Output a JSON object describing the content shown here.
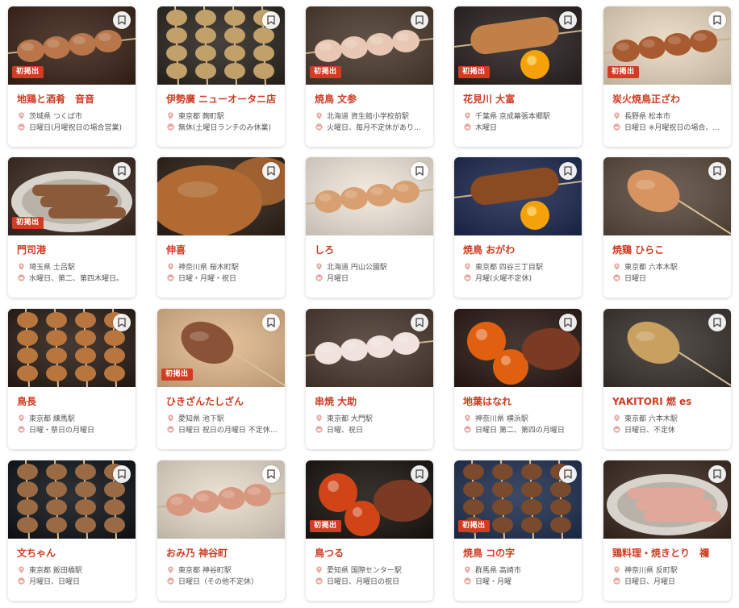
{
  "colors": {
    "accent": "#cf3c22",
    "badge_bg": "#d23c22",
    "meta_text": "#555555",
    "icon_pink": "#e8a9a2"
  },
  "icons": {
    "bookmark": "bookmark-icon",
    "location": "location-pin-icon",
    "holiday": "closed-day-icon"
  },
  "cards": [
    {
      "name": "地鶏と酒肴　音音",
      "location": "茨城県 つくば市",
      "holiday": "日曜日(月曜祝日の場合営業)",
      "badge": "初掲出",
      "photo": {
        "bg": "#3a2418",
        "food": "#b9764a",
        "style": "skewer"
      }
    },
    {
      "name": "伊勢廣 ニューオータニ店",
      "location": "東京都 麹町駅",
      "holiday": "無休(土曜日ランチのみ休業)",
      "badge": "",
      "photo": {
        "bg": "#2b2620",
        "food": "#c2a06a",
        "style": "sticks"
      }
    },
    {
      "name": "焼鳥 文参",
      "location": "北海道 資生館小学校前駅",
      "holiday": "火曜日、毎月不定休があり…",
      "badge": "初掲出",
      "photo": {
        "bg": "#4a3a2c",
        "food": "#e8c8b4",
        "style": "skewer"
      }
    },
    {
      "name": "花見川 大富",
      "location": "千葉県 京成幕張本郷駅",
      "holiday": "木曜日",
      "badge": "初掲出",
      "photo": {
        "bg": "#2a2220",
        "food": "#c08048",
        "style": "tsukune-yolk"
      }
    },
    {
      "name": "炭火焼鳥正ざわ",
      "location": "長野県 松本市",
      "holiday": "日曜日 ※月曜祝日の場合、…",
      "badge": "初掲出",
      "photo": {
        "bg": "#e8d8c0",
        "food": "#a85a30",
        "style": "skewer"
      }
    },
    {
      "name": "門司港",
      "location": "埼玉県 土呂駅",
      "holiday": "水曜日、第二、第四木曜日。",
      "badge": "初掲出",
      "photo": {
        "bg": "#3c2a22",
        "food": "#8a5a3a",
        "style": "plate"
      }
    },
    {
      "name": "伸喜",
      "location": "神奈川県 桜木町駅",
      "holiday": "日曜・月曜・祝日",
      "badge": "",
      "photo": {
        "bg": "#2e2218",
        "food": "#b06a32",
        "style": "closeup"
      }
    },
    {
      "name": "しろ",
      "location": "北海道 円山公園駅",
      "holiday": "月曜日",
      "badge": "",
      "photo": {
        "bg": "#f0e6da",
        "food": "#d8a070",
        "style": "skewer"
      }
    },
    {
      "name": "焼鳥 おがわ",
      "location": "東京都 四谷三丁目駅",
      "holiday": "月曜(火曜不定休)",
      "badge": "",
      "photo": {
        "bg": "#1e2a50",
        "food": "#8a4a22",
        "style": "tsukune-yolk"
      }
    },
    {
      "name": "焼鶏 ひらこ",
      "location": "東京都 六本木駅",
      "holiday": "日曜日",
      "badge": "",
      "photo": {
        "bg": "#5a4a3c",
        "food": "#d89460",
        "style": "single"
      }
    },
    {
      "name": "鳥長",
      "location": "東京都 練馬駅",
      "holiday": "日曜・祭日の月曜日",
      "badge": "",
      "photo": {
        "bg": "#2a1e16",
        "food": "#b8763e",
        "style": "sticks"
      }
    },
    {
      "name": "ひきざんたしざん",
      "location": "愛知県 池下駅",
      "holiday": "日曜日 祝日の月曜日 不定休…",
      "badge": "初掲出",
      "photo": {
        "bg": "#e0b88c",
        "food": "#8a5236",
        "style": "single"
      }
    },
    {
      "name": "串焼 大助",
      "location": "東京都 大門駅",
      "holiday": "日曜、祝日",
      "badge": "",
      "photo": {
        "bg": "#4a3a30",
        "food": "#f0e2dc",
        "style": "skewer"
      }
    },
    {
      "name": "地葉はなれ",
      "location": "神奈川県 横浜駅",
      "holiday": "日曜日 第二、第四の月曜日",
      "badge": "",
      "photo": {
        "bg": "#2a1a14",
        "food": "#e06010",
        "style": "yolks"
      }
    },
    {
      "name": "YAKITORI 燃 es",
      "location": "東京都 六本木駅",
      "holiday": "日曜日、不定休",
      "badge": "",
      "photo": {
        "bg": "#3a3430",
        "food": "#c8a060",
        "style": "single"
      }
    },
    {
      "name": "文ちゃん",
      "location": "東京都 飯田橋駅",
      "holiday": "月曜日、日曜日",
      "badge": "",
      "photo": {
        "bg": "#101418",
        "food": "#9a6a44",
        "style": "sticks"
      }
    },
    {
      "name": "おみ乃 神谷町",
      "location": "東京都 神谷町駅",
      "holiday": "日曜日（その他不定休）",
      "badge": "",
      "photo": {
        "bg": "#e8dccc",
        "food": "#d89880",
        "style": "skewer"
      }
    },
    {
      "name": "鳥つる",
      "location": "愛知県 国際センター駅",
      "holiday": "日曜日、月曜日の祝日",
      "badge": "初掲出",
      "photo": {
        "bg": "#1a1410",
        "food": "#d04418",
        "style": "yolks"
      }
    },
    {
      "name": "焼鳥 コの字",
      "location": "群馬県 高崎市",
      "holiday": "日曜・月曜",
      "badge": "初掲出",
      "photo": {
        "bg": "#203050",
        "food": "#7a4a2c",
        "style": "sticks"
      }
    },
    {
      "name": "鶏料理・焼きとり　禰",
      "location": "神奈川県 反町駅",
      "holiday": "日曜日、月曜日",
      "badge": "",
      "photo": {
        "bg": "#3a2a20",
        "food": "#e0a898",
        "style": "plate"
      }
    }
  ]
}
